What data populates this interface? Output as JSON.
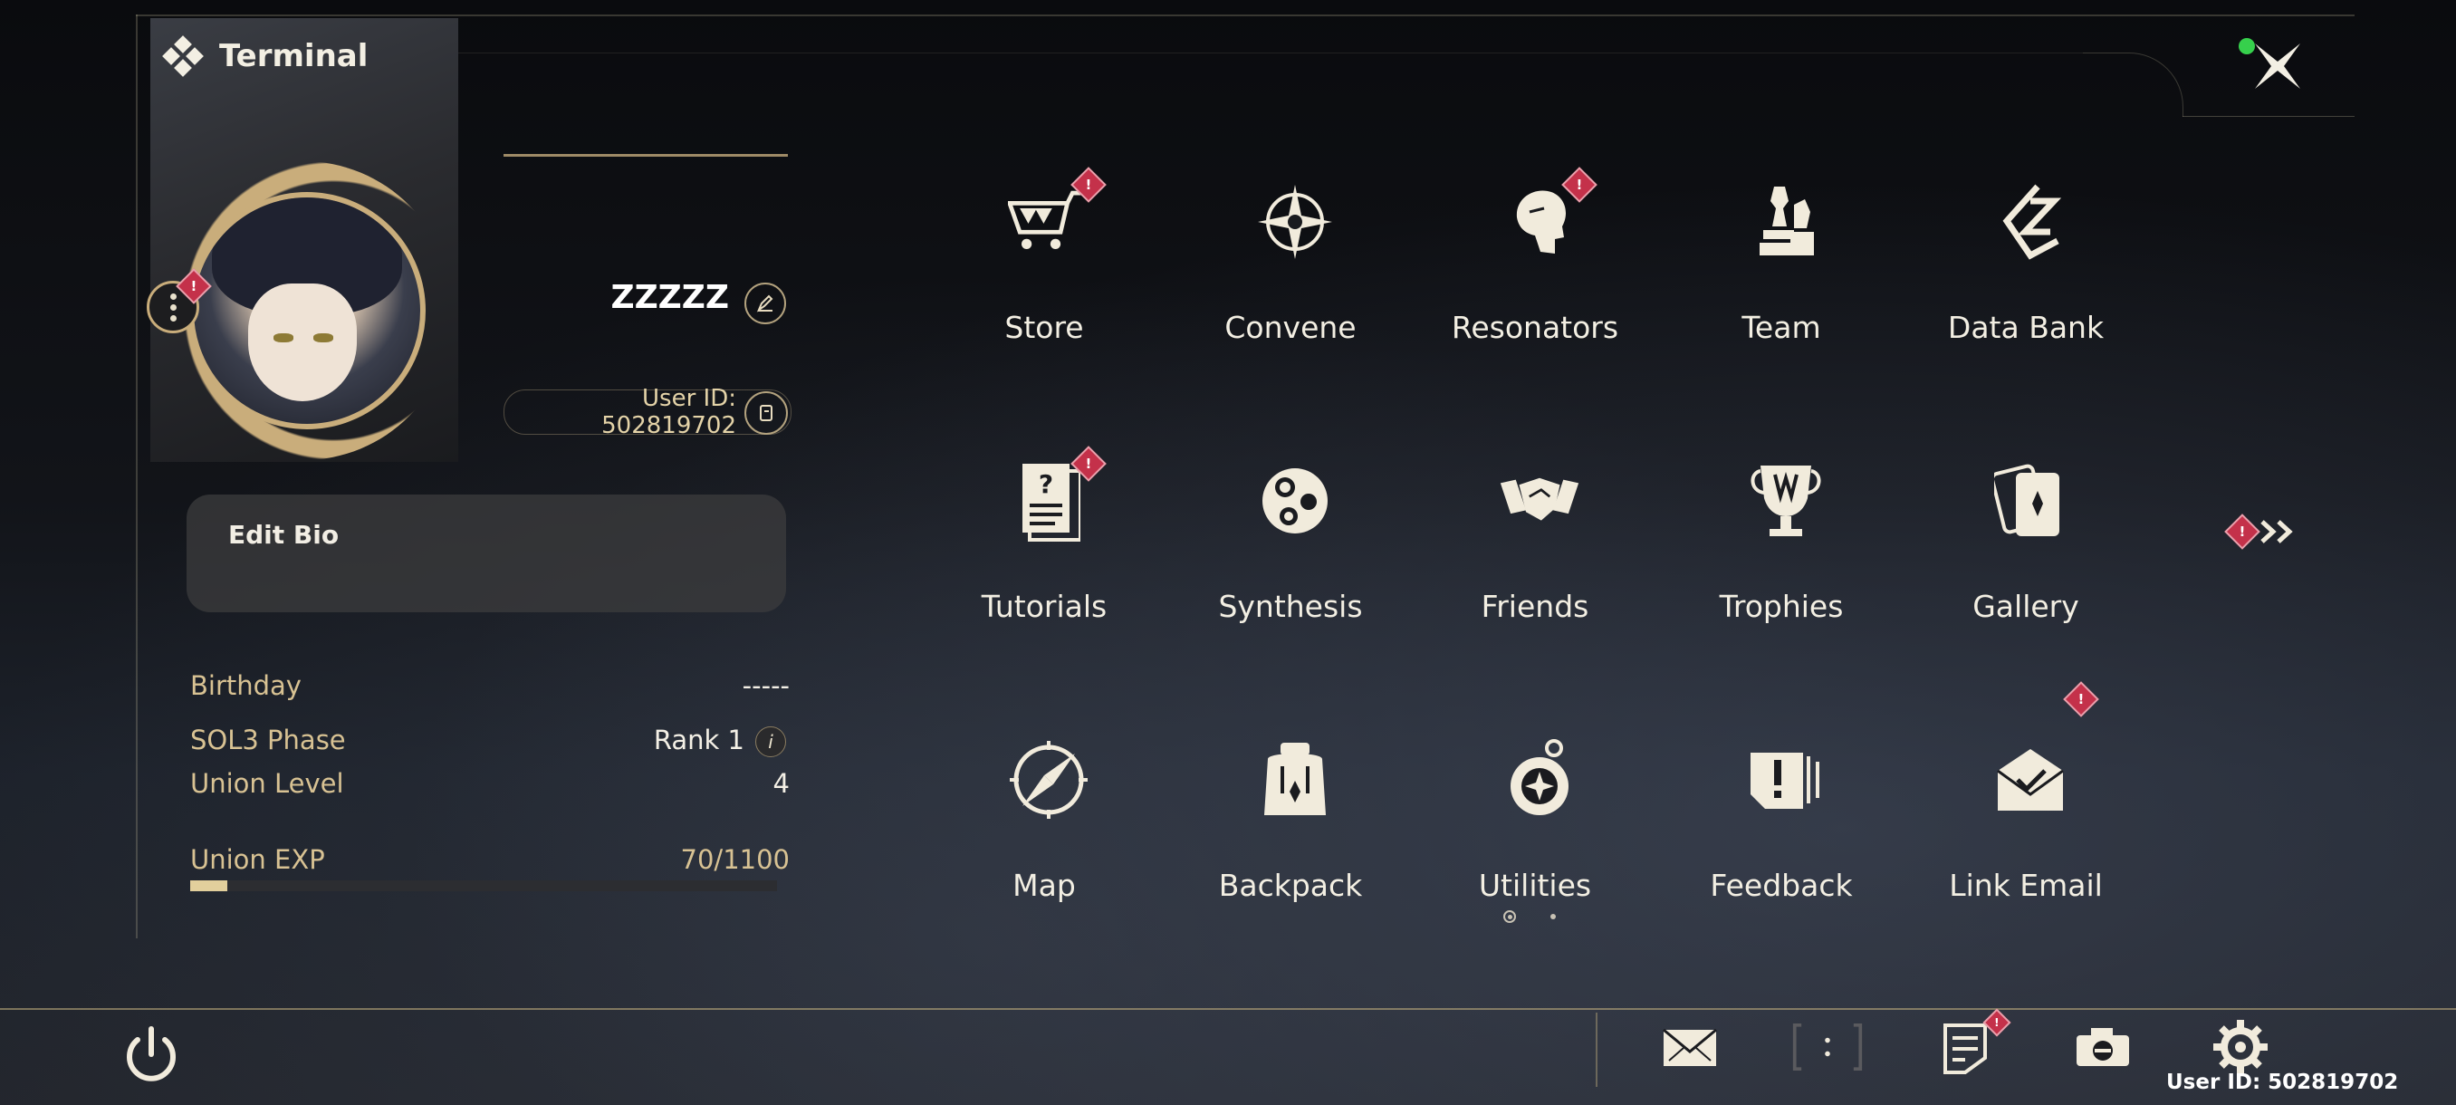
{
  "header": {
    "title": "Terminal"
  },
  "profile": {
    "username": "ZZZZZ",
    "user_id": "User ID: 502819702",
    "bio_label": "Edit Bio",
    "stats": [
      {
        "label": "Birthday",
        "value": "-----"
      },
      {
        "label": "SOL3 Phase",
        "value": "Rank 1",
        "info": "i"
      },
      {
        "label": "Union Level",
        "value": "4"
      }
    ],
    "exp_label": "Union EXP",
    "exp_value": "70/1100",
    "exp_fraction": 0.064
  },
  "menu": [
    {
      "label": "Store",
      "icon": "cart-icon",
      "badge": "!"
    },
    {
      "label": "Convene",
      "icon": "compass-star-icon",
      "badge": ""
    },
    {
      "label": "Resonators",
      "icon": "character-head-icon",
      "badge": "!"
    },
    {
      "label": "Team",
      "icon": "chess-team-icon",
      "badge": ""
    },
    {
      "label": "Data Bank",
      "icon": "data-bank-icon",
      "badge": ""
    },
    {
      "label": "Tutorials",
      "icon": "question-document-icon",
      "badge": "!"
    },
    {
      "label": "Synthesis",
      "icon": "synthesis-orb-icon",
      "badge": ""
    },
    {
      "label": "Friends",
      "icon": "handshake-icon",
      "badge": ""
    },
    {
      "label": "Trophies",
      "icon": "trophy-icon",
      "badge": ""
    },
    {
      "label": "Gallery",
      "icon": "cards-icon",
      "badge": ""
    },
    {
      "label": "Map",
      "icon": "map-compass-icon",
      "badge": ""
    },
    {
      "label": "Backpack",
      "icon": "backpack-icon",
      "badge": ""
    },
    {
      "label": "Utilities",
      "icon": "utilities-icon",
      "badge": ""
    },
    {
      "label": "Feedback",
      "icon": "feedback-icon",
      "badge": ""
    },
    {
      "label": "Link Email",
      "icon": "email-link-icon",
      "badge": "!"
    }
  ],
  "badge_text": "!",
  "bottom_bar": {
    "user_id": "User ID: 502819702",
    "icons": [
      "mail-icon",
      "chat-bracket-icon",
      "notice-icon",
      "camera-icon",
      "settings-icon"
    ]
  },
  "pagination": {
    "current": 1,
    "total": 2
  },
  "colors": {
    "accent_gold": "#c9ad7b",
    "alert_red": "#c4314a",
    "status_green": "#36d04c"
  }
}
